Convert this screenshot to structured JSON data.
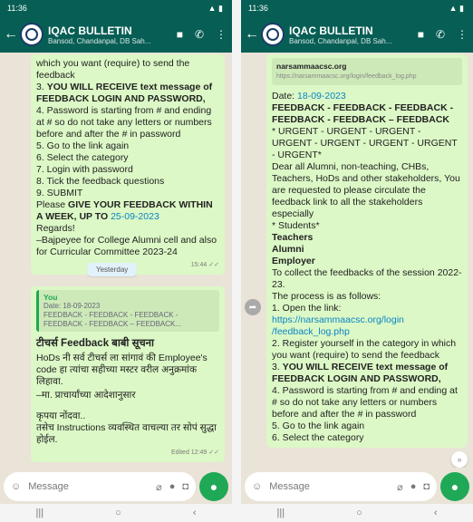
{
  "status": {
    "time1": "11:36",
    "time2": "11:36"
  },
  "chat": {
    "name": "IQAC BULLETIN",
    "subtitle": "Bansod, Chandanpal, DB Sah..."
  },
  "left": {
    "lines_top": [
      "which you want (require) to send the",
      "feedback"
    ],
    "item3_prefix": "3.",
    "item3": "YOU WILL RECEIVE text message of FEEDBACK LOGIN AND PASSWORD,",
    "item4": "4.  Password is starting from # and ending at # so do not take any letters or numbers before and after the # in password",
    "item5": "5.  Go to the link again",
    "item6": "6.  Select the category",
    "item7": "7.  Login with password",
    "item8": "8.  Tick the feedback questions",
    "item9": "9.  SUBMIT",
    "please_prefix": "Please",
    "please_bold": "GIVE YOUR FEEDBACK WITHIN A WEEK, UP TO",
    "deadline": "25-09-2023",
    "regards": "Regards!",
    "signature": "–Bajpeyee for College Alumni cell and also for Curricular Committee 2023-24",
    "time": "15:44",
    "day_label": "Yesterday",
    "quote_you": "You",
    "quote_l1": "Date: 18-09-2023",
    "quote_l2": "FEEDBACK - FEEDBACK - FEEDBACK -",
    "quote_l3": "FEEDBACK - FEEDBACK – FEEDBACK...",
    "m_title": "टीचर्स Feedback बाबी सूचना",
    "m_body": "HoDs नी सर्व टीचर्स ला सांगावं की Employee's code हा त्यांचा सहीच्या मस्टर वरील अनुक्रमांक लिहावा.",
    "m_sig": "–मा. प्राचार्यांच्या आदेशानुसार",
    "m_please": "कृपया नोंदवा..",
    "m_note": "तसेच Instructions व्यवस्थित वाचल्या तर सोपं सुद्धा होईल.",
    "m_time": "Edited 12:49"
  },
  "right": {
    "preview_title": "narsammaacsc.org",
    "preview_url": "https://narsammaacsc.org/login/feedback_log.php",
    "date_prefix": "Date:",
    "date": "18-09-2023",
    "heading": "FEEDBACK - FEEDBACK - FEEDBACK - FEEDBACK - FEEDBACK – FEEDBACK",
    "urgent": "* URGENT - URGENT - URGENT - URGENT - URGENT - URGENT - URGENT - URGENT*",
    "dear": "Dear all Alumni, non-teaching, CHBs, Teachers, HoDs and other stakeholders, You are requested to please circulate the feedback link to all the stakeholders especially",
    "students": "* Students*",
    "teachers": "Teachers",
    "alumni": "Alumni",
    "employer": "Employer",
    "collect": "To collect the feedbacks of the session 2022-23.",
    "process": "The process is as follows:",
    "s1": "1.  Open the link:",
    "link": "https://narsammaacsc.org/login /feedback_log.php",
    "s2": "2.  Register yourself in the category in which you want (require) to send the feedback",
    "s3_prefix": "3.",
    "s3": "YOU WILL RECEIVE text message of FEEDBACK LOGIN AND PASSWORD,",
    "s4": "4.  Password is starting from # and ending at # so do not take any letters or numbers before and after the # in password",
    "s5": "5.  Go to the link again",
    "s6": "6.  Select the category"
  },
  "composer": {
    "placeholder": "Message"
  }
}
